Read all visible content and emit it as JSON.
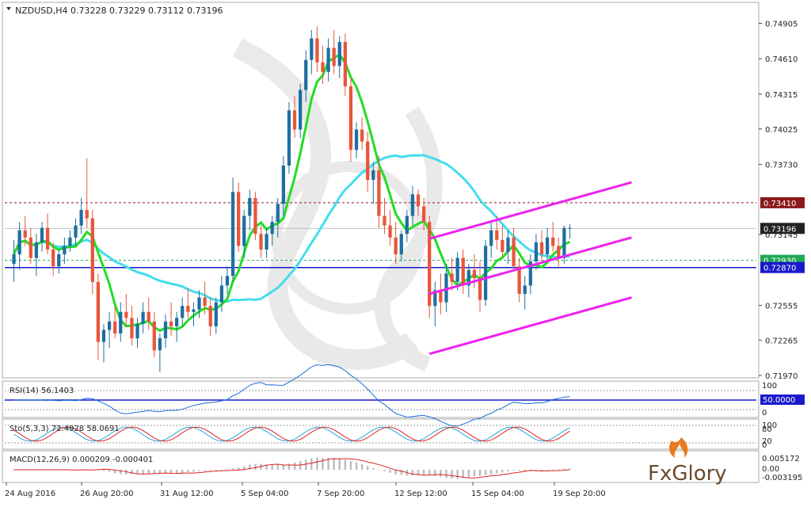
{
  "header": {
    "symbol": "NZDUSD,H4",
    "ohlc": "0.73228 0.73229 0.73112 0.73196"
  },
  "colors": {
    "bull": "#1e6fa0",
    "bear": "#e8553a",
    "ma_fast": "#22dd22",
    "ma_slow": "#44ddee",
    "channel": "#ee22ee",
    "resistance": "#8b1a1a",
    "support": "#1a1acc",
    "green_level": "#22a855"
  },
  "price_axis": {
    "ticks": [
      "0.74905",
      "0.74610",
      "0.74315",
      "0.74025",
      "0.73730",
      "0.73145",
      "0.72555",
      "0.72265",
      "0.71970"
    ]
  },
  "levels": {
    "resistance": {
      "label": "0.73410",
      "value": 0.7341
    },
    "current": {
      "label": "0.73196",
      "value": 0.73196
    },
    "green": {
      "label": "0.72930",
      "value": 0.7293
    },
    "support": {
      "label": "0.72870",
      "value": 0.7287
    }
  },
  "indicators": {
    "rsi": {
      "title": "RSI(14) 56.1403",
      "axis_top": "100",
      "level_label": "50.0000",
      "axis_bottom": "0"
    },
    "stoch": {
      "title": "Sto(5,3,3) 72.4928 58.0691",
      "axis_top": "100",
      "axis_80": "80",
      "axis_20": "20",
      "axis_bottom": "0"
    },
    "macd": {
      "title": "MACD(12,26,9) 0.000209 -0.000401",
      "axis_top": "0.005172",
      "axis_zero": "0.00",
      "axis_bottom": "-0.003195"
    }
  },
  "time_axis": [
    "24 Aug 2016",
    "26 Aug 20:00",
    "31 Aug 12:00",
    "5 Sep 04:00",
    "7 Sep 20:00",
    "12 Sep 12:00",
    "15 Sep 04:00",
    "19 Sep 20:00"
  ],
  "watermark": "FxGlory",
  "chart_data": {
    "type": "candlestick",
    "symbol": "NZDUSD",
    "timeframe": "H4",
    "ylim": [
      0.7197,
      0.7506
    ],
    "candles": [
      [
        0.729,
        0.731,
        0.7275,
        0.7298
      ],
      [
        0.7298,
        0.7325,
        0.7285,
        0.7318
      ],
      [
        0.7318,
        0.733,
        0.7305,
        0.7312
      ],
      [
        0.7312,
        0.732,
        0.729,
        0.7295
      ],
      [
        0.7295,
        0.7315,
        0.728,
        0.7308
      ],
      [
        0.7308,
        0.7325,
        0.73,
        0.732
      ],
      [
        0.732,
        0.7332,
        0.7298,
        0.7302
      ],
      [
        0.7302,
        0.7308,
        0.728,
        0.7288
      ],
      [
        0.7288,
        0.7302,
        0.7282,
        0.7298
      ],
      [
        0.7298,
        0.7312,
        0.729,
        0.7305
      ],
      [
        0.7305,
        0.7318,
        0.73,
        0.7312
      ],
      [
        0.7312,
        0.7328,
        0.7305,
        0.7322
      ],
      [
        0.7322,
        0.7345,
        0.7315,
        0.7335
      ],
      [
        0.7335,
        0.7378,
        0.732,
        0.7328
      ],
      [
        0.7328,
        0.7335,
        0.7265,
        0.7275
      ],
      [
        0.7275,
        0.7282,
        0.721,
        0.7225
      ],
      [
        0.7225,
        0.724,
        0.7208,
        0.7235
      ],
      [
        0.7235,
        0.725,
        0.722,
        0.7242
      ],
      [
        0.7242,
        0.7255,
        0.7228,
        0.7232
      ],
      [
        0.7232,
        0.7258,
        0.7225,
        0.725
      ],
      [
        0.725,
        0.7265,
        0.7238,
        0.7245
      ],
      [
        0.7245,
        0.7255,
        0.7222,
        0.7228
      ],
      [
        0.7228,
        0.7245,
        0.722,
        0.724
      ],
      [
        0.724,
        0.7258,
        0.7232,
        0.725
      ],
      [
        0.725,
        0.7262,
        0.7235,
        0.7242
      ],
      [
        0.7242,
        0.725,
        0.7212,
        0.7218
      ],
      [
        0.7218,
        0.7232,
        0.72,
        0.7228
      ],
      [
        0.7228,
        0.7248,
        0.722,
        0.7242
      ],
      [
        0.7242,
        0.7258,
        0.723,
        0.7238
      ],
      [
        0.7238,
        0.725,
        0.7225,
        0.7245
      ],
      [
        0.7245,
        0.7262,
        0.7238,
        0.7255
      ],
      [
        0.7255,
        0.727,
        0.7245,
        0.725
      ],
      [
        0.725,
        0.7258,
        0.7238,
        0.7252
      ],
      [
        0.7252,
        0.7268,
        0.7245,
        0.7262
      ],
      [
        0.7262,
        0.7275,
        0.7248,
        0.7255
      ],
      [
        0.7255,
        0.7262,
        0.723,
        0.7238
      ],
      [
        0.7238,
        0.7262,
        0.7232,
        0.7258
      ],
      [
        0.7258,
        0.728,
        0.725,
        0.7272
      ],
      [
        0.7272,
        0.7288,
        0.7265,
        0.728
      ],
      [
        0.728,
        0.7362,
        0.7275,
        0.735
      ],
      [
        0.735,
        0.7358,
        0.73,
        0.7305
      ],
      [
        0.7305,
        0.7335,
        0.7295,
        0.733
      ],
      [
        0.733,
        0.7352,
        0.7318,
        0.7345
      ],
      [
        0.7345,
        0.735,
        0.731,
        0.7315
      ],
      [
        0.7315,
        0.7322,
        0.7295,
        0.7302
      ],
      [
        0.7302,
        0.732,
        0.7295,
        0.7315
      ],
      [
        0.7315,
        0.733,
        0.7305,
        0.7325
      ],
      [
        0.7325,
        0.7345,
        0.7312,
        0.734
      ],
      [
        0.734,
        0.738,
        0.733,
        0.7372
      ],
      [
        0.7372,
        0.7425,
        0.7365,
        0.7418
      ],
      [
        0.7418,
        0.743,
        0.7395,
        0.7402
      ],
      [
        0.7402,
        0.744,
        0.7395,
        0.7435
      ],
      [
        0.7435,
        0.7468,
        0.7425,
        0.746
      ],
      [
        0.746,
        0.7485,
        0.7448,
        0.7478
      ],
      [
        0.7478,
        0.7488,
        0.745,
        0.7458
      ],
      [
        0.7458,
        0.7472,
        0.744,
        0.745
      ],
      [
        0.745,
        0.7478,
        0.7442,
        0.747
      ],
      [
        0.747,
        0.7485,
        0.7448,
        0.7455
      ],
      [
        0.7455,
        0.748,
        0.7445,
        0.7475
      ],
      [
        0.7475,
        0.7482,
        0.743,
        0.7438
      ],
      [
        0.7438,
        0.7445,
        0.7375,
        0.7385
      ],
      [
        0.7385,
        0.7408,
        0.7378,
        0.7402
      ],
      [
        0.7402,
        0.7412,
        0.7385,
        0.7392
      ],
      [
        0.7392,
        0.74,
        0.735,
        0.736
      ],
      [
        0.736,
        0.7375,
        0.734,
        0.7368
      ],
      [
        0.7368,
        0.738,
        0.732,
        0.733
      ],
      [
        0.733,
        0.7345,
        0.7315,
        0.7322
      ],
      [
        0.7322,
        0.7335,
        0.7305,
        0.7312
      ],
      [
        0.7312,
        0.7325,
        0.729,
        0.7298
      ],
      [
        0.7298,
        0.7318,
        0.7292,
        0.7315
      ],
      [
        0.7315,
        0.7335,
        0.7308,
        0.733
      ],
      [
        0.733,
        0.7355,
        0.7322,
        0.7348
      ],
      [
        0.7348,
        0.7352,
        0.733,
        0.7338
      ],
      [
        0.7338,
        0.7345,
        0.7318,
        0.7325
      ],
      [
        0.7325,
        0.733,
        0.7245,
        0.7255
      ],
      [
        0.7255,
        0.7275,
        0.7238,
        0.7268
      ],
      [
        0.7268,
        0.7282,
        0.7248,
        0.7258
      ],
      [
        0.7258,
        0.729,
        0.725,
        0.7282
      ],
      [
        0.7282,
        0.7295,
        0.7268,
        0.7275
      ],
      [
        0.7275,
        0.73,
        0.7268,
        0.7295
      ],
      [
        0.7295,
        0.7302,
        0.7265,
        0.7272
      ],
      [
        0.7272,
        0.729,
        0.7262,
        0.7285
      ],
      [
        0.7285,
        0.7298,
        0.727,
        0.7278
      ],
      [
        0.7278,
        0.7292,
        0.725,
        0.726
      ],
      [
        0.726,
        0.731,
        0.7255,
        0.7305
      ],
      [
        0.7305,
        0.7325,
        0.7295,
        0.7318
      ],
      [
        0.7318,
        0.733,
        0.7302,
        0.731
      ],
      [
        0.731,
        0.7322,
        0.7295,
        0.73
      ],
      [
        0.73,
        0.7318,
        0.729,
        0.7312
      ],
      [
        0.7312,
        0.732,
        0.7285,
        0.7288
      ],
      [
        0.7288,
        0.7295,
        0.7258,
        0.7265
      ],
      [
        0.7265,
        0.728,
        0.7252,
        0.7272
      ],
      [
        0.7272,
        0.7298,
        0.7265,
        0.7292
      ],
      [
        0.7292,
        0.7315,
        0.7285,
        0.7308
      ],
      [
        0.7308,
        0.7318,
        0.729,
        0.7298
      ],
      [
        0.7298,
        0.732,
        0.7292,
        0.7312
      ],
      [
        0.7312,
        0.7325,
        0.73,
        0.7305
      ],
      [
        0.7305,
        0.7312,
        0.7288,
        0.7295
      ],
      [
        0.7295,
        0.7322,
        0.729,
        0.732
      ],
      [
        0.732,
        0.7323,
        0.7311,
        0.732
      ]
    ]
  }
}
